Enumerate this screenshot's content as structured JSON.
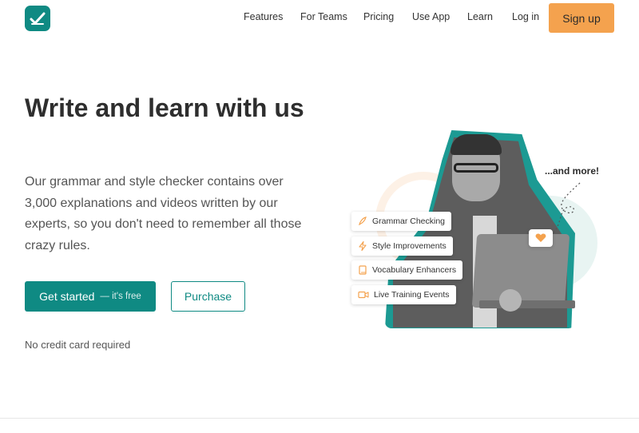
{
  "nav": {
    "items": [
      {
        "label": "Features"
      },
      {
        "label": "For Teams"
      },
      {
        "label": "Pricing"
      },
      {
        "label": "Use App"
      },
      {
        "label": "Learn"
      },
      {
        "label": "Log in"
      }
    ],
    "signup_label": "Sign up"
  },
  "hero": {
    "title": "Write and learn with us",
    "description": "Our grammar and style checker contains over 3,000 explanations and videos written by our experts, so you don't need to remember all those crazy rules.",
    "primary_button": "Get started",
    "primary_button_note": "— it's free",
    "secondary_button": "Purchase",
    "note": "No credit card required"
  },
  "illustration": {
    "and_more": "...and more!",
    "features": [
      {
        "label": "Grammar Checking",
        "icon": "quill-icon"
      },
      {
        "label": "Style Improvements",
        "icon": "lightning-icon"
      },
      {
        "label": "Vocabulary Enhancers",
        "icon": "book-icon"
      },
      {
        "label": "Live Training Events",
        "icon": "video-camera-icon"
      }
    ]
  },
  "colors": {
    "brand": "#0f8a83",
    "accent": "#f4a24e"
  }
}
